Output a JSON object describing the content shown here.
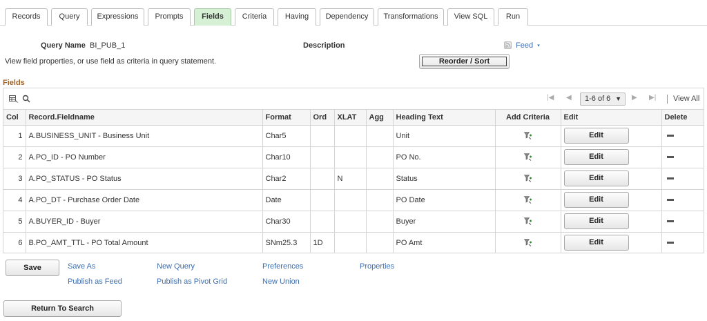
{
  "tabs": [
    {
      "label": "Records",
      "active": false
    },
    {
      "label": "Query",
      "active": false
    },
    {
      "label": "Expressions",
      "active": false
    },
    {
      "label": "Prompts",
      "active": false
    },
    {
      "label": "Fields",
      "active": true
    },
    {
      "label": "Criteria",
      "active": false
    },
    {
      "label": "Having",
      "active": false
    },
    {
      "label": "Dependency",
      "active": false
    },
    {
      "label": "Transformations",
      "active": false
    },
    {
      "label": "View SQL",
      "active": false
    },
    {
      "label": "Run",
      "active": false
    }
  ],
  "query": {
    "name_label": "Query Name",
    "name_value": "BI_PUB_1",
    "description_label": "Description",
    "feed_label": "Feed",
    "instructions": "View field properties, or use field as criteria in query statement.",
    "reorder_label": "Reorder / Sort"
  },
  "grid": {
    "title": "Fields",
    "pagination": "1-6 of 6",
    "view_all": "View All",
    "columns": [
      "Col",
      "Record.Fieldname",
      "Format",
      "Ord",
      "XLAT",
      "Agg",
      "Heading Text",
      "Add Criteria",
      "Edit",
      "Delete"
    ],
    "rows": [
      {
        "col": "1",
        "fieldname": "A.BUSINESS_UNIT - Business Unit",
        "format": "Char5",
        "ord": "",
        "xlat": "",
        "agg": "",
        "heading": "Unit",
        "edit": "Edit"
      },
      {
        "col": "2",
        "fieldname": "A.PO_ID - PO Number",
        "format": "Char10",
        "ord": "",
        "xlat": "",
        "agg": "",
        "heading": "PO No.",
        "edit": "Edit"
      },
      {
        "col": "3",
        "fieldname": "A.PO_STATUS - PO Status",
        "format": "Char2",
        "ord": "",
        "xlat": "N",
        "agg": "",
        "heading": "Status",
        "edit": "Edit"
      },
      {
        "col": "4",
        "fieldname": "A.PO_DT - Purchase Order Date",
        "format": "Date",
        "ord": "",
        "xlat": "",
        "agg": "",
        "heading": "PO Date",
        "edit": "Edit"
      },
      {
        "col": "5",
        "fieldname": "A.BUYER_ID - Buyer",
        "format": "Char30",
        "ord": "",
        "xlat": "",
        "agg": "",
        "heading": "Buyer",
        "edit": "Edit"
      },
      {
        "col": "6",
        "fieldname": "B.PO_AMT_TTL - PO Total Amount",
        "format": "SNm25.3",
        "ord": "1D",
        "xlat": "",
        "agg": "",
        "heading": "PO Amt",
        "edit": "Edit"
      }
    ]
  },
  "actions": {
    "save": "Save",
    "save_as": "Save As",
    "publish_feed": "Publish as Feed",
    "new_query": "New Query",
    "publish_pivot": "Publish as Pivot Grid",
    "preferences": "Preferences",
    "new_union": "New Union",
    "properties": "Properties",
    "return_search": "Return To Search"
  },
  "icons": {
    "grid_personalize": "grid-personalize-icon",
    "search": "search-icon",
    "feed": "feed-icon",
    "add_criteria": "criteria-filter-icon",
    "delete": "delete-row-icon"
  },
  "colors": {
    "active_tab": "#d6f0d6",
    "link": "#3b6db1",
    "section_title": "#a0642a"
  }
}
